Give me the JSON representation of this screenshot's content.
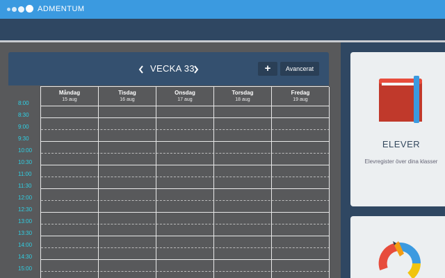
{
  "app": {
    "name": "ADMENTUM"
  },
  "calendar": {
    "week_label": "VECKA 33",
    "prev_icon": "chevron-left-icon",
    "next_icon": "chevron-right-icon",
    "add_label": "+",
    "advanced_label": "Avancerat",
    "days": [
      {
        "name": "Måndag",
        "date": "15 aug"
      },
      {
        "name": "Tisdag",
        "date": "16 aug"
      },
      {
        "name": "Onsdag",
        "date": "17 aug"
      },
      {
        "name": "Torsdag",
        "date": "18 aug"
      },
      {
        "name": "Fredag",
        "date": "19 aug"
      }
    ],
    "times": [
      "8:00",
      "8:30",
      "9:00",
      "9:30",
      "10:00",
      "10:30",
      "11:00",
      "11:30",
      "12:00",
      "12:30",
      "13:00",
      "13:30",
      "14:00",
      "14:30",
      "15:00"
    ]
  },
  "cards": [
    {
      "title": "ELEVER",
      "description": "Elevregister över dina klasser",
      "icon": "book-icon"
    },
    {
      "icon": "pencil-chart-icon"
    }
  ],
  "colors": {
    "topbar": "#3b9ae0",
    "accent_time": "#2fd0e4",
    "panel": "#34506f"
  }
}
